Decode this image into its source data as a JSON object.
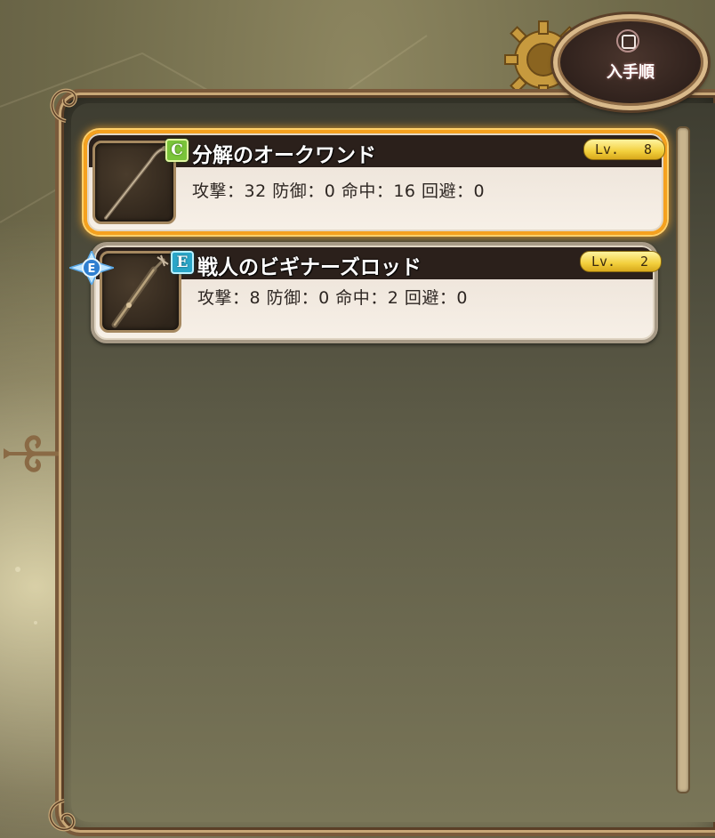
{
  "sort_button": {
    "label": "入手順",
    "icon": "square-button-icon"
  },
  "items": [
    {
      "rank": "C",
      "name": "分解のオークワンド",
      "level_label": "Lv.",
      "level": "8",
      "stats": "攻撃：32 防御：0 命中：16 回避：0",
      "selected": true,
      "equipped": false,
      "icon": "wand-icon"
    },
    {
      "rank": "E",
      "name": "戦人のビギナーズロッド",
      "level_label": "Lv.",
      "level": "2",
      "stats": "攻撃：8 防御：0 命中：2 回避：0",
      "selected": false,
      "equipped": true,
      "equipped_marker": "E",
      "icon": "rod-icon"
    }
  ],
  "colors": {
    "selected_border": "#f5a11f",
    "rank_c": "#7ac43a",
    "rank_e": "#2aa6c8",
    "level_pill": "#f2cf3c"
  }
}
